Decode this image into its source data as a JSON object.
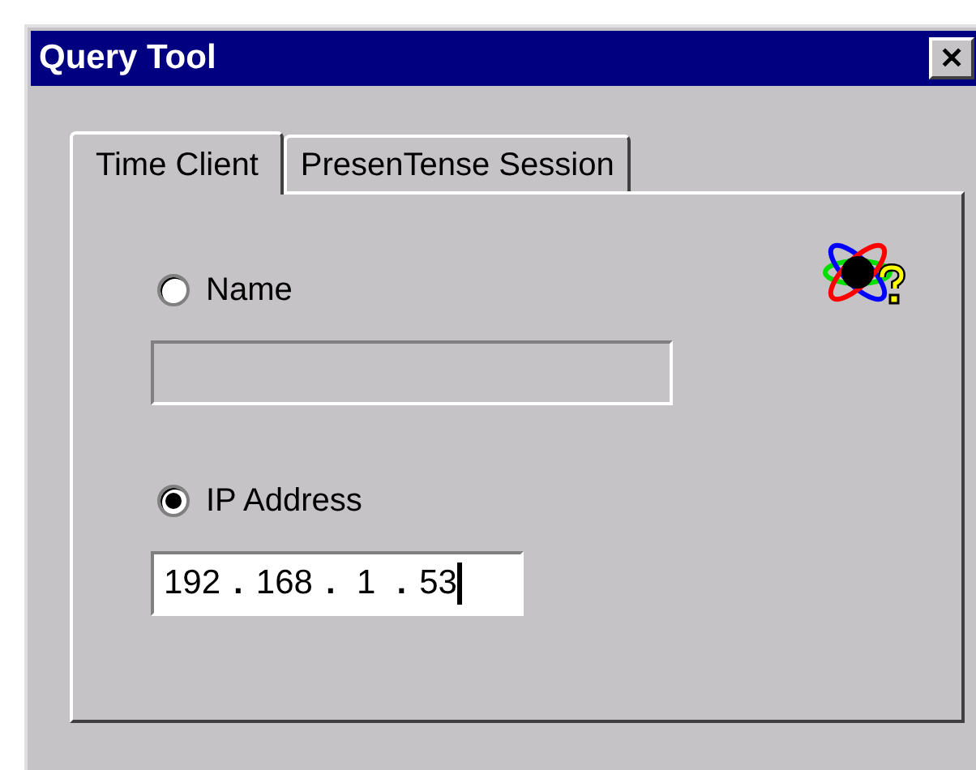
{
  "window": {
    "title": "Query Tool",
    "close": "✕"
  },
  "tabs": [
    {
      "label": "Time Client",
      "selected": true
    },
    {
      "label": "PresenTense Session",
      "selected": false
    }
  ],
  "options": [
    {
      "kind": "text",
      "label": "Name",
      "selected": false
    },
    {
      "kind": "ip",
      "label": "IP Address",
      "selected": true,
      "octets": [
        "192",
        "168",
        "1",
        "53"
      ],
      "separators": [
        ".",
        ".",
        "."
      ],
      "focused": true
    }
  ]
}
